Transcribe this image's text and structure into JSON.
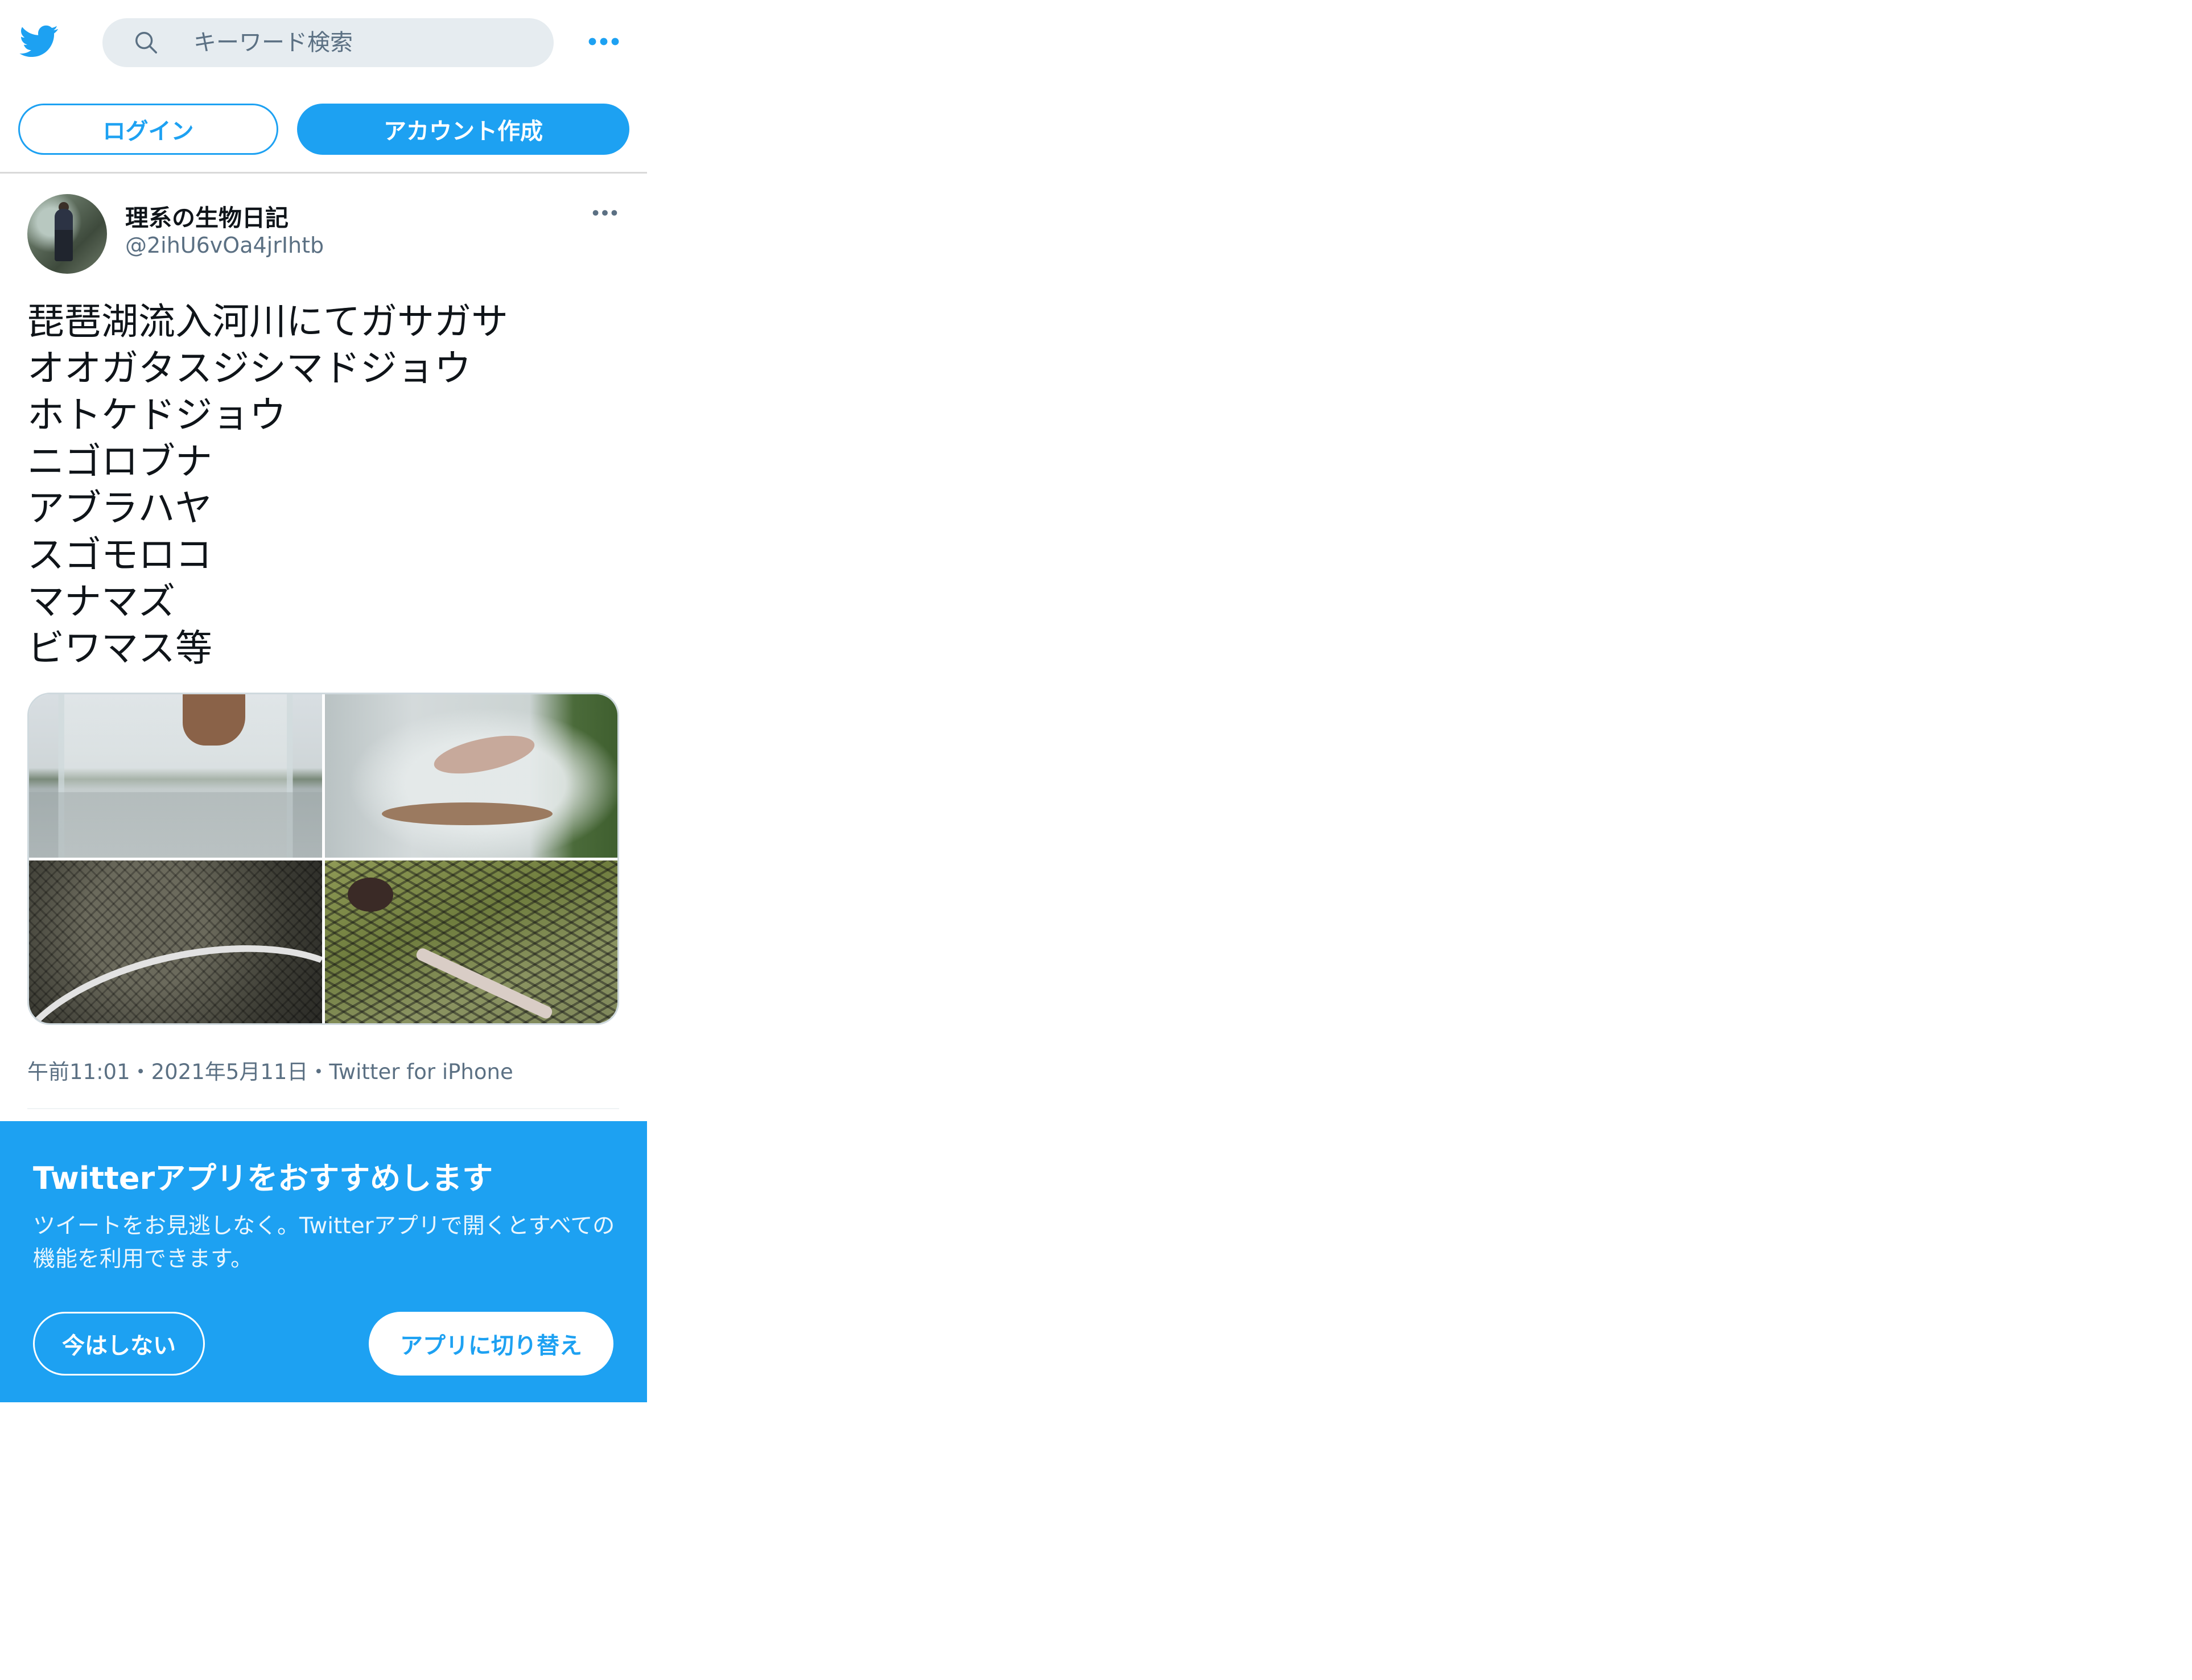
{
  "header": {
    "search_placeholder": "キーワード検索"
  },
  "auth": {
    "login_label": "ログイン",
    "signup_label": "アカウント作成"
  },
  "tweet": {
    "display_name": "理系の生物日記",
    "handle": "@2ihU6vOa4jrIhtb",
    "text_lines": [
      "琵琶湖流入河川にてガサガサ",
      "オオガタスジシマドジョウ",
      "ホトケドジョウ",
      "ニゴロブナ",
      "アブラハヤ",
      "スゴモロコ",
      "マナマズ",
      "ビワマス等"
    ],
    "meta": "午前11:01・2021年5月11日・Twitter for iPhone"
  },
  "promo": {
    "title": "Twitterアプリをおすすめします",
    "body": "ツイートをお見逃しなく。Twitterアプリで開くとすべての機能を利用できます。",
    "not_now_label": "今はしない",
    "switch_label": "アプリに切り替え"
  },
  "colors": {
    "accent": "#1da1f2",
    "secondary_text": "#5b7083",
    "search_bg": "#e6ecf0"
  },
  "icons": [
    "twitter-logo-icon",
    "search-icon",
    "more-icon",
    "avatar"
  ]
}
